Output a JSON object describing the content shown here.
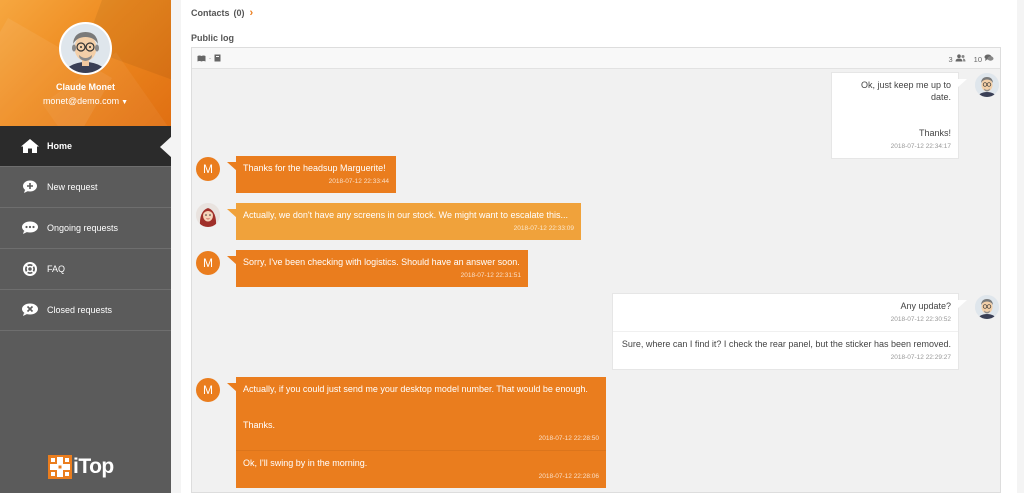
{
  "user": {
    "name": "Claude Monet",
    "email": "monet@demo.com"
  },
  "nav": {
    "items": [
      {
        "label": "Home",
        "icon": "home-icon"
      },
      {
        "label": "New request",
        "icon": "new-request-icon"
      },
      {
        "label": "Ongoing requests",
        "icon": "ongoing-requests-icon"
      },
      {
        "label": "FAQ",
        "icon": "lifebuoy-icon"
      },
      {
        "label": "Closed requests",
        "icon": "closed-requests-icon"
      }
    ]
  },
  "brand": {
    "logo_text": "iTop",
    "accent_color": "#ea7d1e",
    "accent_light": "#f0a23b",
    "sidebar_bg": "#5b5b5b"
  },
  "contacts": {
    "label": "Contacts",
    "count": "(0)"
  },
  "public_log": {
    "title": "Public log",
    "participants_count": "3",
    "messages_count": "10",
    "messages": [
      {
        "side": "right",
        "avatar": "avatar-monet",
        "parts": [
          {
            "lines": [
              "Ok, just keep me up to date.",
              "",
              "Thanks!"
            ],
            "timestamp": "2018-07-12 22:34:17"
          }
        ]
      },
      {
        "side": "left",
        "avatar_letter": "M",
        "parts": [
          {
            "lines": [
              "Thanks for the headsup Marguerite!"
            ],
            "timestamp": "2018-07-12 22:33:44"
          }
        ]
      },
      {
        "side": "left",
        "avatar": "avatar-marguerite",
        "style": "light",
        "parts": [
          {
            "lines": [
              "Actually, we don't have any screens in our stock. We might want to escalate this..."
            ],
            "timestamp": "2018-07-12 22:33:09"
          }
        ]
      },
      {
        "side": "left",
        "avatar_letter": "M",
        "parts": [
          {
            "lines": [
              "Sorry, I've been checking with logistics. Should have an answer soon."
            ],
            "timestamp": "2018-07-12 22:31:51"
          }
        ]
      },
      {
        "side": "right",
        "avatar": "avatar-monet",
        "parts": [
          {
            "lines": [
              "Any update?"
            ],
            "timestamp": "2018-07-12 22:30:52"
          },
          {
            "lines": [
              "Sure, where can I find it? I check the rear panel, but the sticker has been removed."
            ],
            "timestamp": "2018-07-12 22:29:27"
          }
        ]
      },
      {
        "side": "left",
        "avatar_letter": "M",
        "parts": [
          {
            "lines": [
              "Actually, if you could just send me your desktop model number. That would be enough.",
              "",
              "Thanks."
            ],
            "timestamp": "2018-07-12 22:28:50"
          },
          {
            "lines": [
              "Ok, I'll swing by in the morning."
            ],
            "timestamp": "2018-07-12 22:28:06"
          }
        ]
      }
    ]
  }
}
